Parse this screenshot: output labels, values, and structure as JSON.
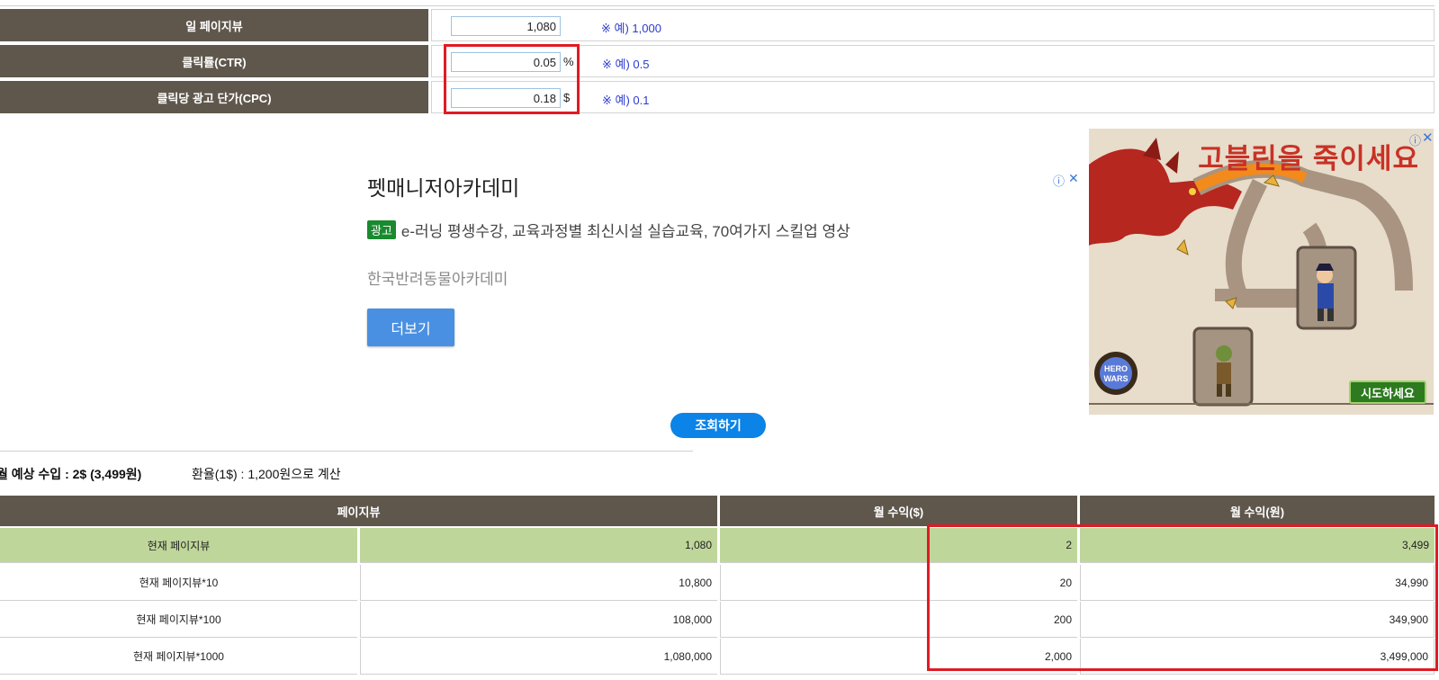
{
  "form": {
    "rows": [
      {
        "label": "일 페이지뷰",
        "value": "1,080",
        "unit": "",
        "hint": "※ 예) 1,000"
      },
      {
        "label": "클릭률(CTR)",
        "value": "0.05",
        "unit": "%",
        "hint": "※ 예) 0.5"
      },
      {
        "label": "클릭당 광고 단가(CPC)",
        "value": "0.18",
        "unit": "$",
        "hint": "※ 예) 0.1"
      }
    ]
  },
  "ad": {
    "title": "펫매니저아카데미",
    "badge": "광고",
    "description": "e-러닝 평생수강, 교육과정별 최신시설 실습교육, 70여가지 스킬업 영상",
    "advertiser": "한국반려동물아카데미",
    "more_label": "더보기",
    "info_icon": "info-icon",
    "close_icon": "close-icon"
  },
  "game_ad": {
    "headline": "고블린을 죽이세요",
    "cta": "시도하세요",
    "logo": "HERO WARS"
  },
  "query_button": "조회하기",
  "summary": {
    "income": "월 예상 수입 : 2$ (3,499원)",
    "exchange_rate": "환율(1$) : 1,200원으로 계산"
  },
  "table": {
    "headers": [
      "페이지뷰",
      "월 수익($)",
      "월 수익(원)"
    ],
    "rows": [
      {
        "label": "현재 페이지뷰",
        "pageviews": "1,080",
        "usd": "2",
        "krw": "3,499",
        "highlight": true
      },
      {
        "label": "현재 페이지뷰*10",
        "pageviews": "10,800",
        "usd": "20",
        "krw": "34,990",
        "highlight": false
      },
      {
        "label": "현재 페이지뷰*100",
        "pageviews": "108,000",
        "usd": "200",
        "krw": "349,900",
        "highlight": false
      },
      {
        "label": "현재 페이지뷰*1000",
        "pageviews": "1,080,000",
        "usd": "2,000",
        "krw": "3,499,000",
        "highlight": false
      }
    ]
  },
  "colors": {
    "header_bg": "#5f574c",
    "highlight_row": "#bfd69a",
    "annotation_red": "#e01b24",
    "button_blue": "#0c83e6"
  }
}
